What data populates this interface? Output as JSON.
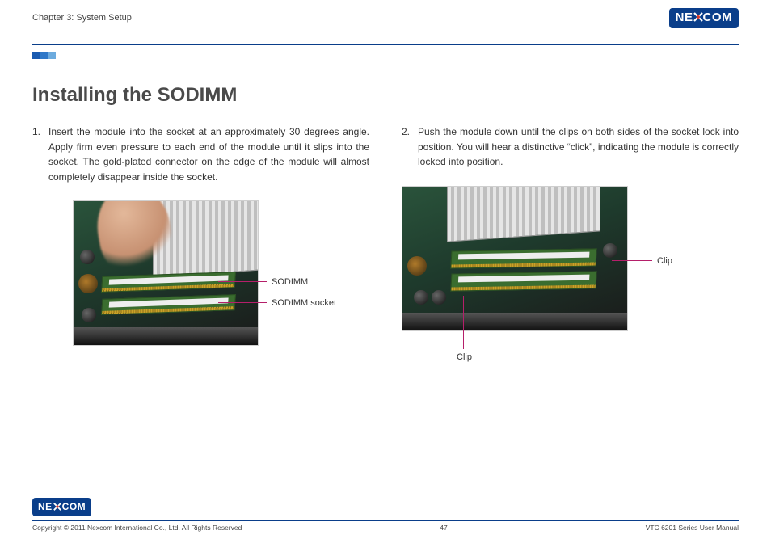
{
  "brand": {
    "name_part1": "NE",
    "name_x": "X",
    "name_part2": "COM"
  },
  "header": {
    "chapter": "Chapter 3: System Setup"
  },
  "title": "Installing the SODIMM",
  "left": {
    "step_num": "1.",
    "step_text": "Insert the module into the socket at an approximately 30 degrees angle. Apply firm even pressure to each end of the module until it slips into the socket. The gold-plated connector on the edge of the module will almost completely disappear inside the socket.",
    "label_sodimm": "SODIMM",
    "label_socket": "SODIMM socket"
  },
  "right": {
    "step_num": "2.",
    "step_text": "Push the module down until the clips on both sides of the socket lock into position. You will hear a distinctive “click”, indicating the module is correctly locked into position.",
    "label_clip_right": "Clip",
    "label_clip_bottom": "Clip"
  },
  "footer": {
    "copyright": "Copyright © 2011 Nexcom International Co., Ltd. All Rights Reserved",
    "page": "47",
    "manual": "VTC 6201 Series User Manual"
  }
}
